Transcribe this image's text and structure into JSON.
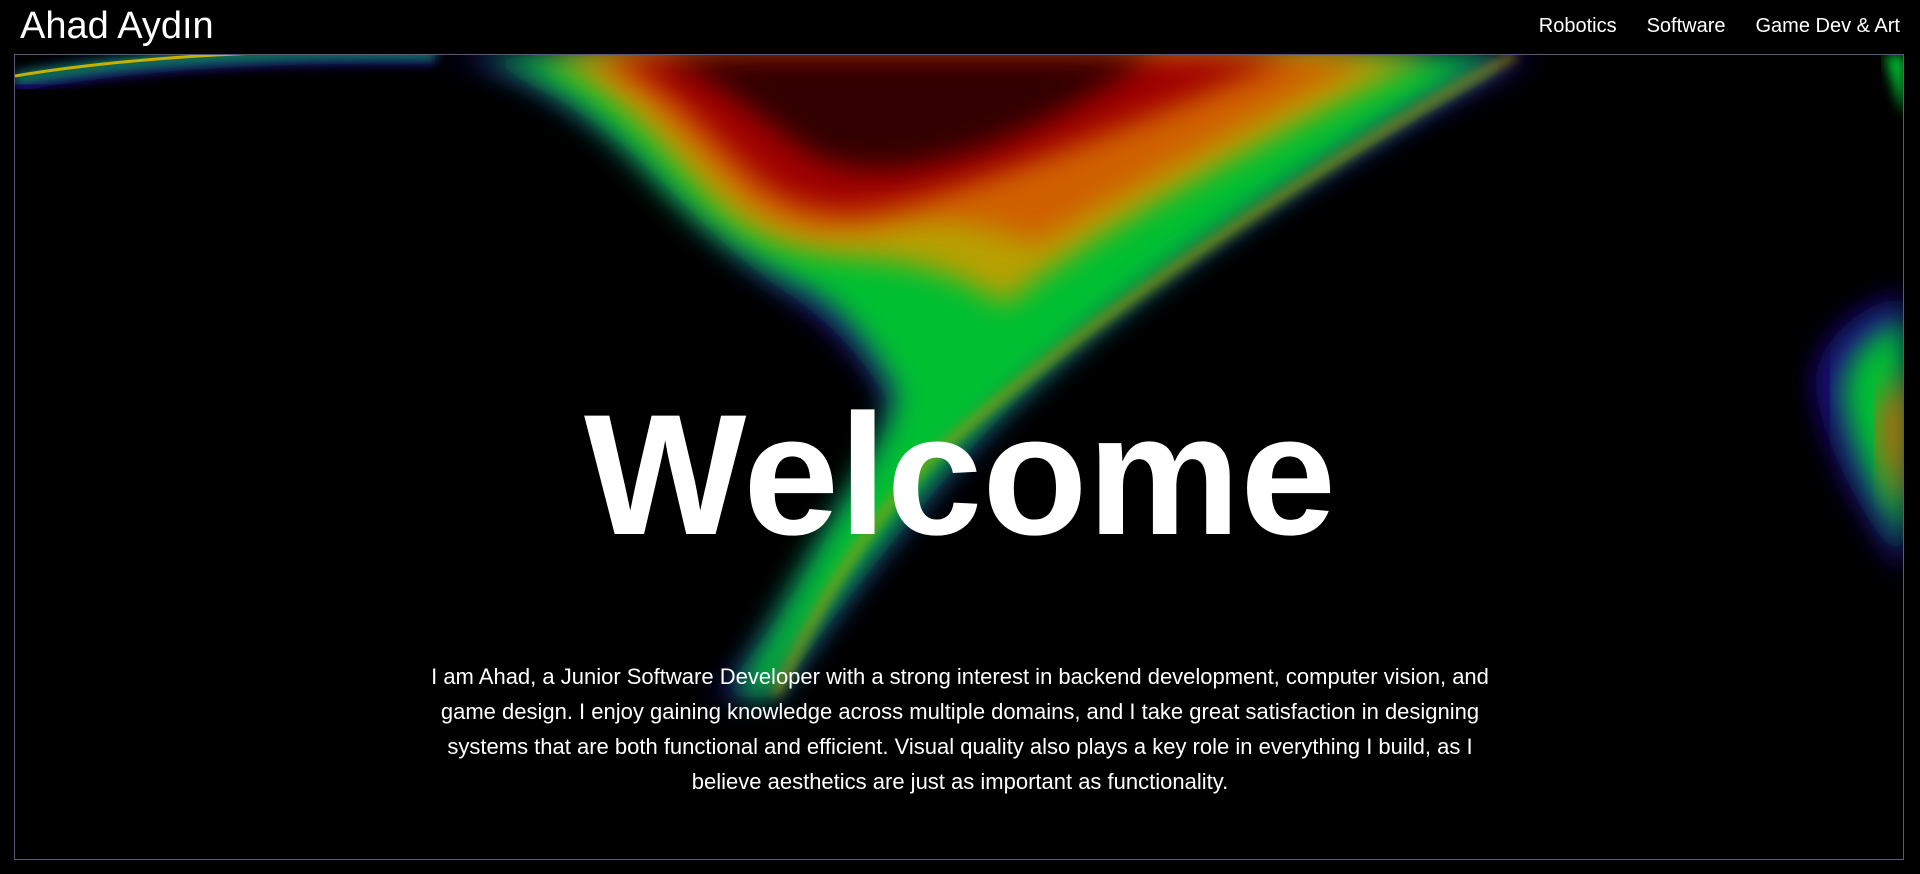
{
  "header": {
    "site_title": "Ahad Aydın",
    "nav": [
      {
        "label": "Robotics"
      },
      {
        "label": "Software"
      },
      {
        "label": "Game Dev & Art"
      }
    ]
  },
  "hero": {
    "heading": "Welcome",
    "intro": "I am Ahad, a Junior Software Developer with a strong interest in backend development, computer vision, and game design. I enjoy gaining knowledge across multiple domains, and I take great satisfaction in designing systems that are both functional and efficient. Visual quality also plays a key role in everything I build, as I believe aesthetics are just as important as functionality."
  },
  "colors": {
    "background": "#000000",
    "text": "#ffffff",
    "frame_border": "#5a5a78",
    "gradient_stops": [
      "#1a0a8a",
      "#00c030",
      "#b8a000",
      "#d06000",
      "#a00000",
      "#200000"
    ]
  }
}
